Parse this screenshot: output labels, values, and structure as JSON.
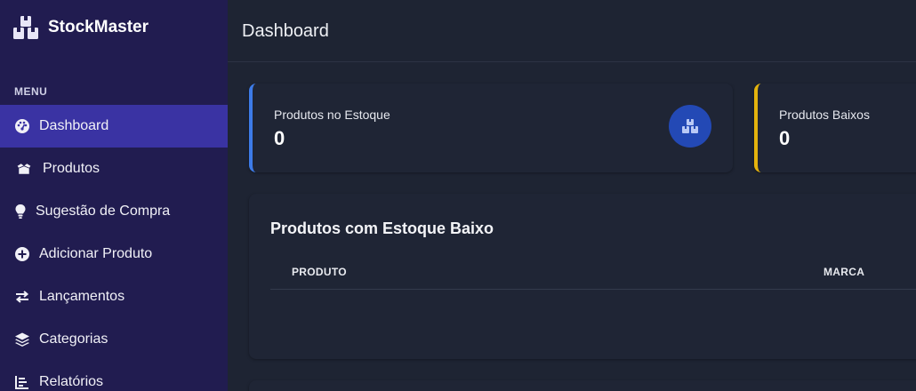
{
  "brand": {
    "name": "StockMaster",
    "icon": "boxes-icon"
  },
  "sidebar": {
    "menu_label": "MENU",
    "items": [
      {
        "label": "Dashboard",
        "icon": "gauge-icon",
        "active": true
      },
      {
        "label": "Produtos",
        "icon": "box-open-icon",
        "active": false
      },
      {
        "label": "Sugestão de Compra",
        "icon": "lightbulb-icon",
        "active": false
      },
      {
        "label": "Adicionar Produto",
        "icon": "plus-circle-icon",
        "active": false
      },
      {
        "label": "Lançamentos",
        "icon": "exchange-icon",
        "active": false
      },
      {
        "label": "Categorias",
        "icon": "layers-icon",
        "active": false
      },
      {
        "label": "Relatórios",
        "icon": "chart-bar-icon",
        "active": false
      }
    ]
  },
  "header": {
    "title": "Dashboard"
  },
  "stats": [
    {
      "label": "Produtos no Estoque",
      "value": "0",
      "accent": "#3d7be8",
      "icon": "boxes-icon"
    },
    {
      "label": "Produtos Baixos",
      "value": "0",
      "accent": "#e4b30d"
    }
  ],
  "low_stock": {
    "title": "Produtos com Estoque Baixo",
    "columns": [
      "PRODUTO",
      "MARCA"
    ],
    "rows": []
  },
  "colors": {
    "sidebar_bg": "#211c50",
    "active_item": "#3a33a3",
    "main_bg": "#1e2433",
    "card_bg": "#1f2535"
  }
}
